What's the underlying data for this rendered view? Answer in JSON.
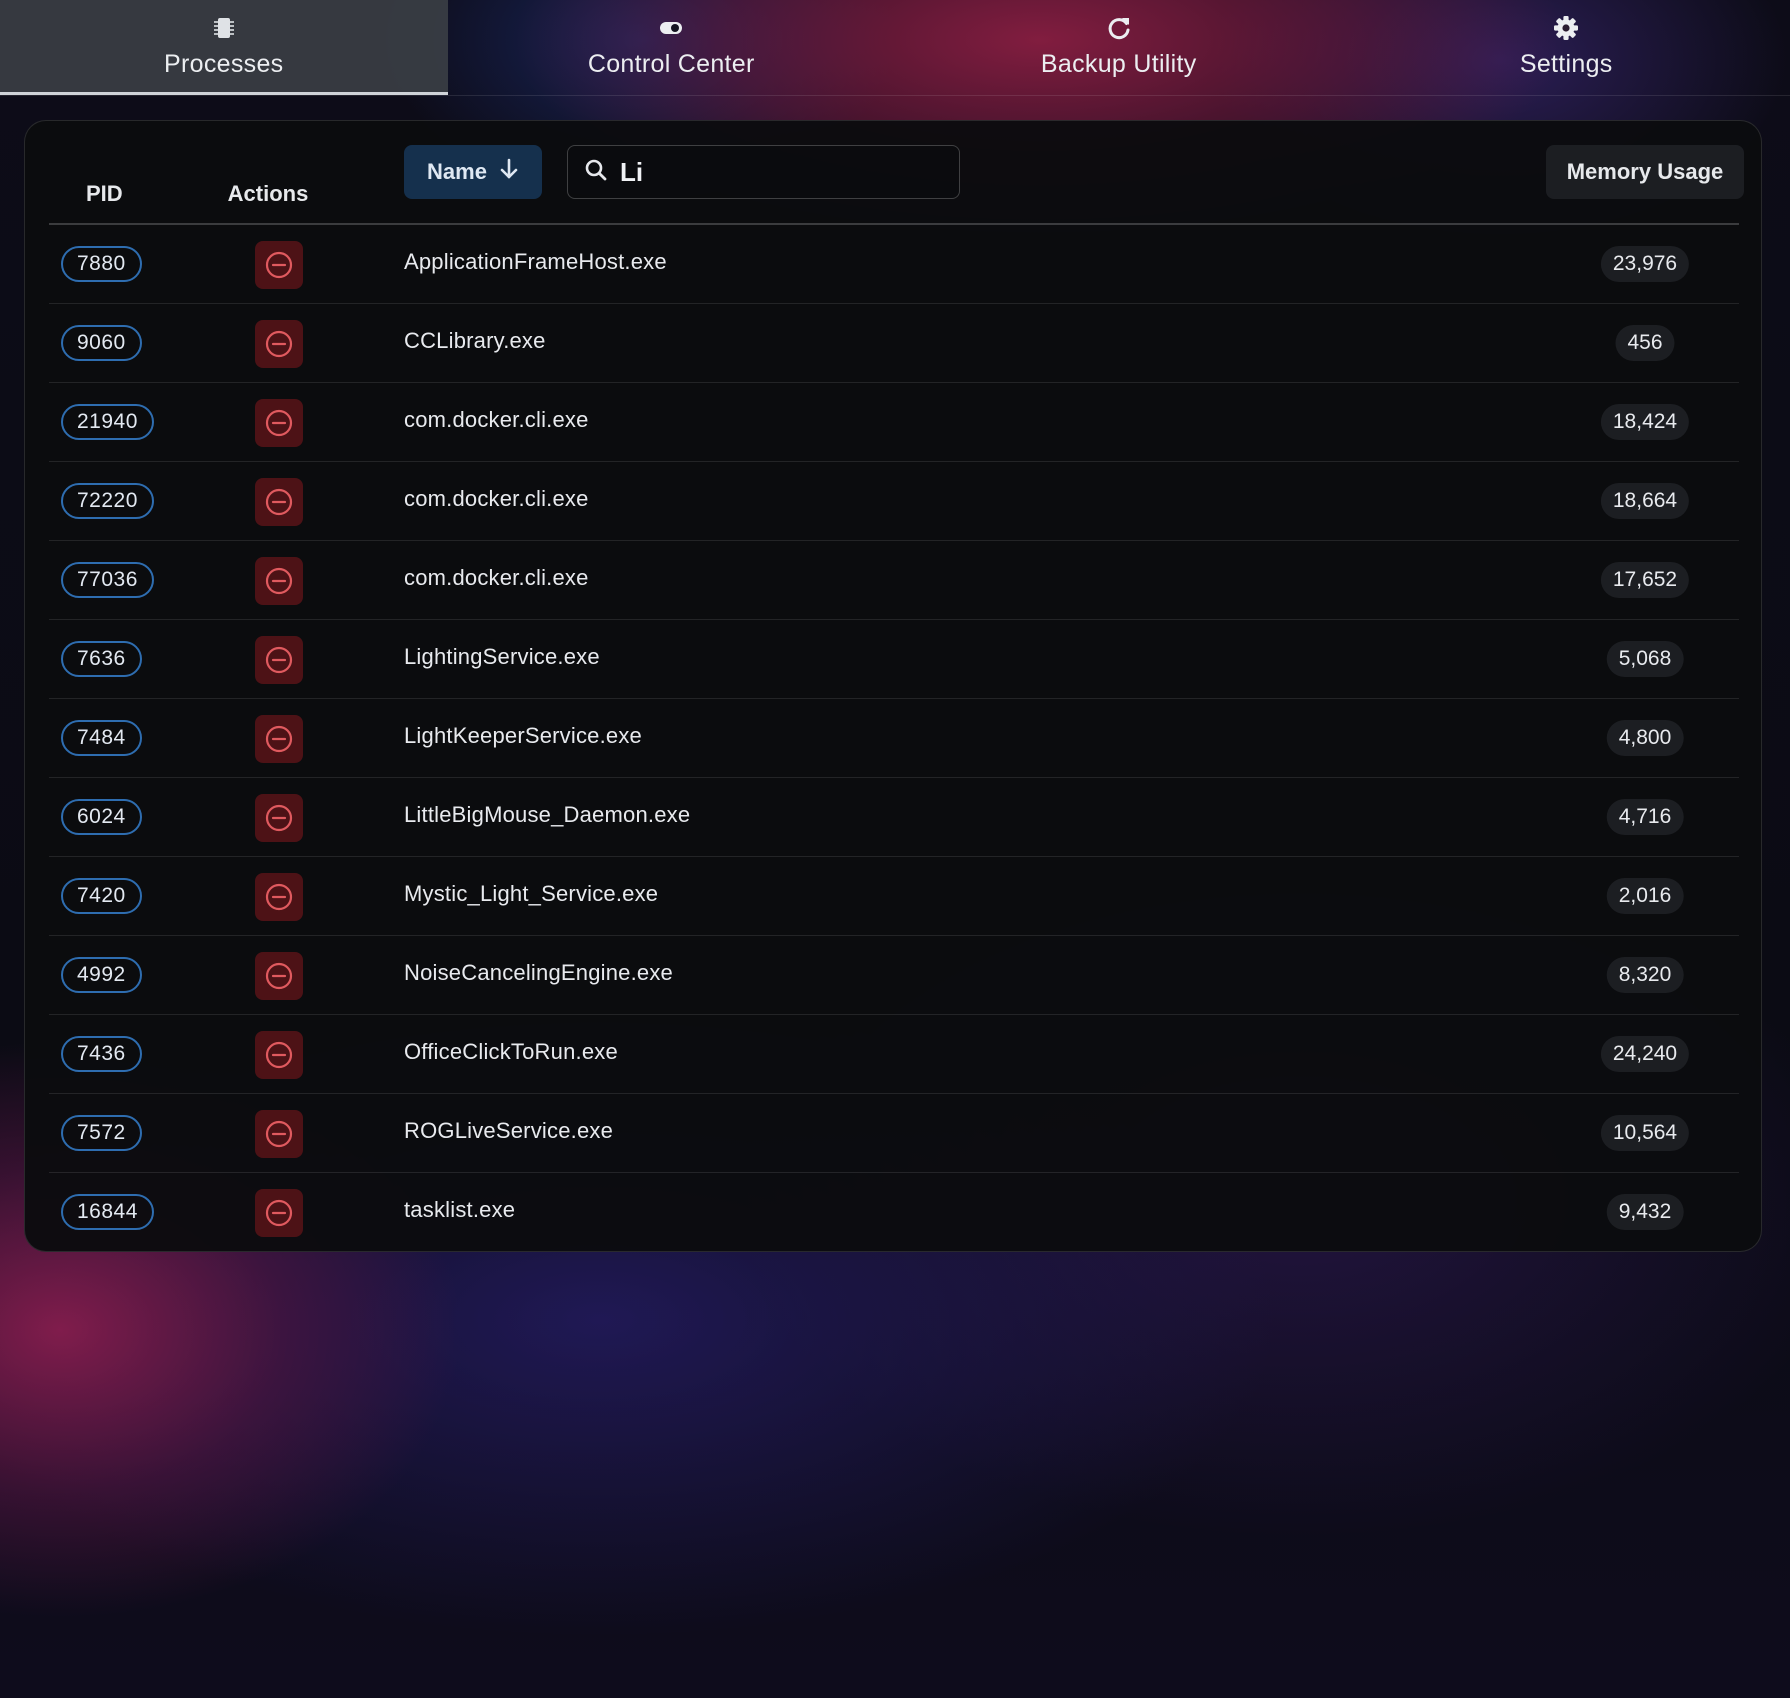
{
  "tabs": [
    {
      "label": "Processes",
      "icon": "chip-icon",
      "active": true
    },
    {
      "label": "Control Center",
      "icon": "toggle-icon",
      "active": false
    },
    {
      "label": "Backup Utility",
      "icon": "refresh-icon",
      "active": false
    },
    {
      "label": "Settings",
      "icon": "gear-icon",
      "active": false
    }
  ],
  "table": {
    "headers": {
      "pid": "PID",
      "actions": "Actions",
      "name": "Name",
      "memory": "Memory Usage"
    },
    "sort": {
      "column": "Name",
      "direction": "descending-arrow"
    },
    "search": {
      "value": "Li",
      "placeholder": ""
    },
    "rows": [
      {
        "pid": "7880",
        "name": "ApplicationFrameHost.exe",
        "memory": "23,976"
      },
      {
        "pid": "9060",
        "name": "CCLibrary.exe",
        "memory": "456"
      },
      {
        "pid": "21940",
        "name": "com.docker.cli.exe",
        "memory": "18,424"
      },
      {
        "pid": "72220",
        "name": "com.docker.cli.exe",
        "memory": "18,664"
      },
      {
        "pid": "77036",
        "name": "com.docker.cli.exe",
        "memory": "17,652"
      },
      {
        "pid": "7636",
        "name": "LightingService.exe",
        "memory": "5,068"
      },
      {
        "pid": "7484",
        "name": "LightKeeperService.exe",
        "memory": "4,800"
      },
      {
        "pid": "6024",
        "name": "LittleBigMouse_Daemon.exe",
        "memory": "4,716"
      },
      {
        "pid": "7420",
        "name": "Mystic_Light_Service.exe",
        "memory": "2,016"
      },
      {
        "pid": "4992",
        "name": "NoiseCancelingEngine.exe",
        "memory": "8,320"
      },
      {
        "pid": "7436",
        "name": "OfficeClickToRun.exe",
        "memory": "24,240"
      },
      {
        "pid": "7572",
        "name": "ROGLiveService.exe",
        "memory": "10,564"
      },
      {
        "pid": "16844",
        "name": "tasklist.exe",
        "memory": "9,432"
      }
    ]
  },
  "colors": {
    "pid_border": "#2e6db0",
    "kill_bg": "#4d1216",
    "kill_icon": "#e05a5f",
    "sort_bg": "#15304d",
    "active_tab_bg": "#3a3e44"
  }
}
